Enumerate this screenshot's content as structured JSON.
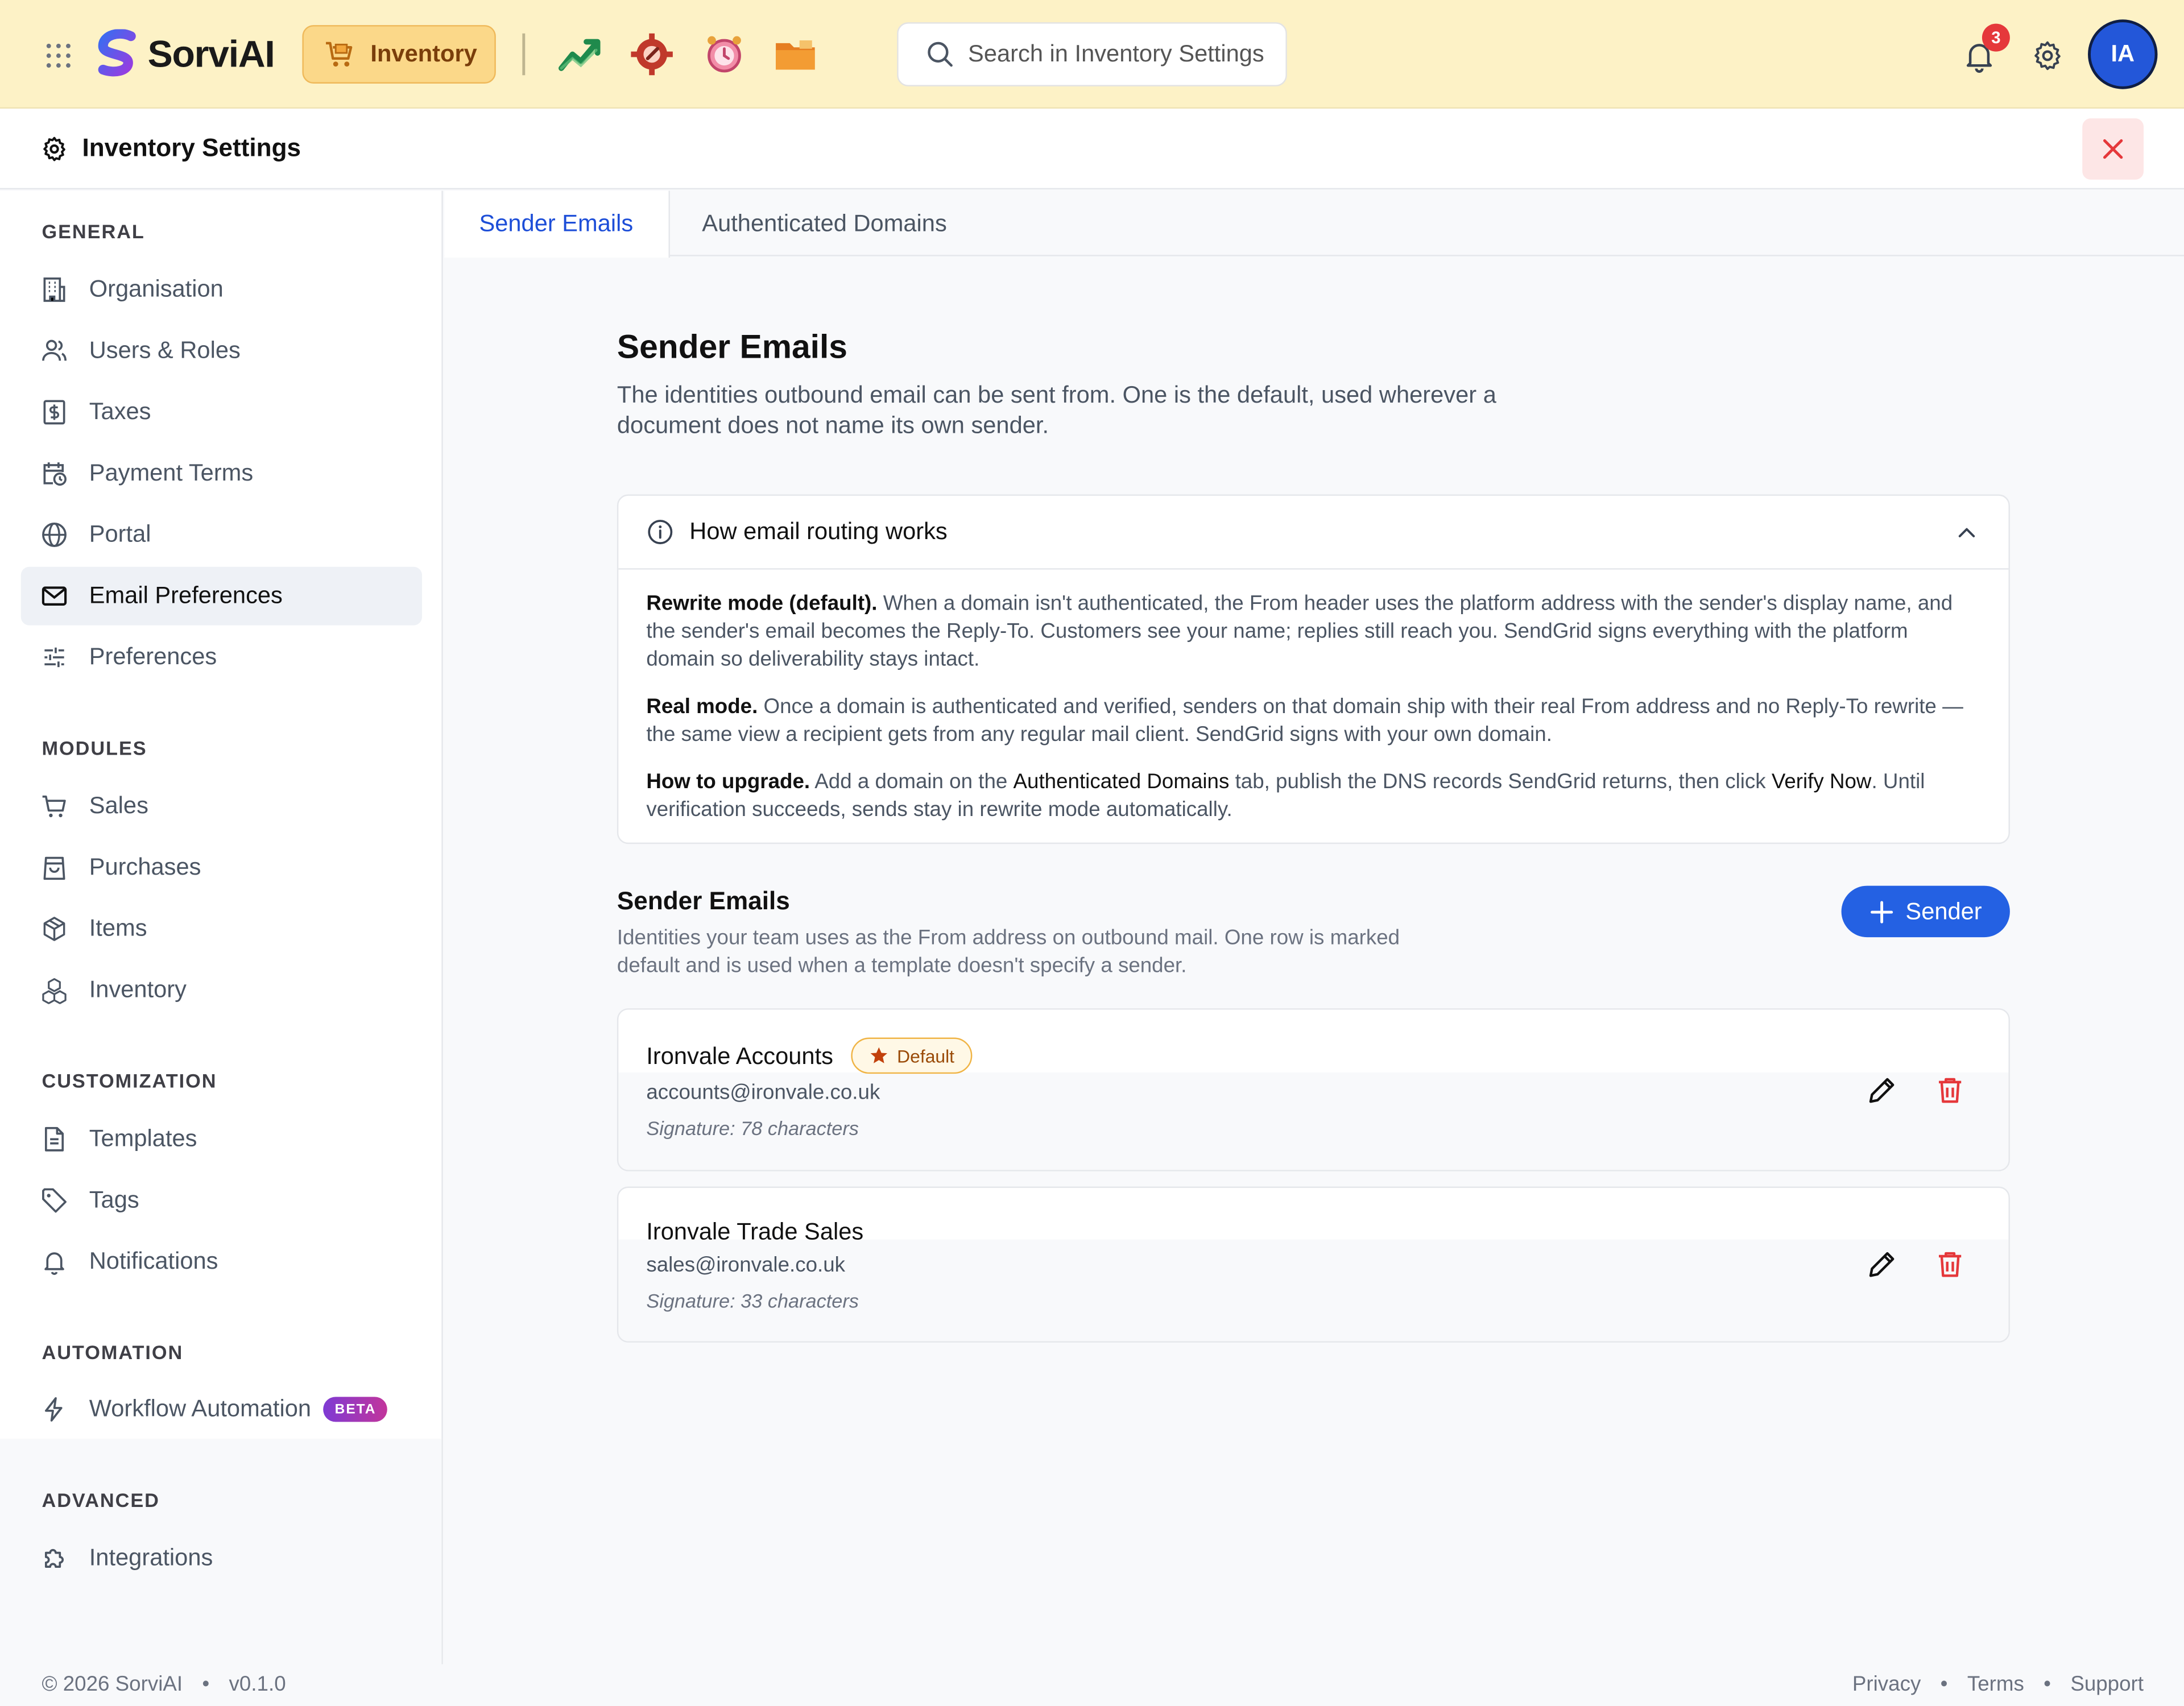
{
  "topbar": {
    "brand": "SorviAI",
    "module_label": "Inventory",
    "search_placeholder": "Search in Inventory Settings",
    "notification_count": "3",
    "avatar_initials": "IA",
    "app_icons": [
      "trending-up-icon",
      "wrench-gear-icon",
      "alarm-clock-icon",
      "folder-icon"
    ]
  },
  "settings_header": {
    "title": "Inventory Settings"
  },
  "sidebar": {
    "sections": [
      {
        "label": "GENERAL",
        "items": [
          {
            "label": "Organisation",
            "icon": "building-icon"
          },
          {
            "label": "Users & Roles",
            "icon": "users-icon"
          },
          {
            "label": "Taxes",
            "icon": "dollar-doc-icon"
          },
          {
            "label": "Payment Terms",
            "icon": "calendar-clock-icon"
          },
          {
            "label": "Portal",
            "icon": "globe-icon"
          },
          {
            "label": "Email Preferences",
            "icon": "mail-icon",
            "active": true
          },
          {
            "label": "Preferences",
            "icon": "sliders-icon"
          }
        ]
      },
      {
        "label": "MODULES",
        "items": [
          {
            "label": "Sales",
            "icon": "cart-icon"
          },
          {
            "label": "Purchases",
            "icon": "shopping-bag-icon"
          },
          {
            "label": "Items",
            "icon": "box-icon"
          },
          {
            "label": "Inventory",
            "icon": "boxes-icon"
          }
        ]
      },
      {
        "label": "CUSTOMIZATION",
        "items": [
          {
            "label": "Templates",
            "icon": "file-icon"
          },
          {
            "label": "Tags",
            "icon": "tag-icon"
          },
          {
            "label": "Notifications",
            "icon": "bell-icon"
          }
        ]
      },
      {
        "label": "AUTOMATION",
        "items": [
          {
            "label": "Workflow Automation",
            "icon": "lightning-icon",
            "badge": "BETA"
          }
        ]
      },
      {
        "label": "ADVANCED",
        "items": [
          {
            "label": "Integrations",
            "icon": "puzzle-icon"
          }
        ]
      }
    ]
  },
  "tabs": [
    {
      "label": "Sender Emails",
      "active": true
    },
    {
      "label": "Authenticated Domains",
      "active": false
    }
  ],
  "main": {
    "title": "Sender Emails",
    "subtitle": "The identities outbound email can be sent from. One is the default, used wherever a document does not name its own sender.",
    "info": {
      "title": "How email routing works",
      "p1_lead": "Rewrite mode (default).",
      "p1_text": " When a domain isn't authenticated, the From header uses the platform address with the sender's display name, and the sender's email becomes the Reply-To. Customers see your name; replies still reach you. SendGrid signs everything with the platform domain so deliverability stays intact.",
      "p2_lead": "Real mode.",
      "p2_text": " Once a domain is authenticated and verified, senders on that domain ship with their real From address and no Reply-To rewrite — the same view a recipient gets from any regular mail client. SendGrid signs with your own domain.",
      "p3_lead": "How to upgrade.",
      "p3_a": " Add a domain on the ",
      "p3_b": "Authenticated Domains",
      "p3_c": " tab, publish the DNS records SendGrid returns, then click ",
      "p3_d": "Verify Now",
      "p3_e": ". Until verification succeeds, sends stay in rewrite mode automatically."
    },
    "list_title": "Sender Emails",
    "list_subtitle": "Identities your team uses as the From address on outbound mail. One row is marked default and is used when a template doesn't specify a sender.",
    "add_button": "Sender",
    "senders": [
      {
        "name": "Ironvale Accounts",
        "badge": "Default",
        "email": "accounts@ironvale.co.uk",
        "signature": "Signature: 78 characters"
      },
      {
        "name": "Ironvale Trade Sales",
        "email": "sales@ironvale.co.uk",
        "signature": "Signature: 33 characters"
      }
    ]
  },
  "footer": {
    "copyright": "© 2026 SorviAI",
    "version": "v0.1.0",
    "links": [
      "Privacy",
      "Terms",
      "Support"
    ],
    "separator": "•"
  },
  "colors": {
    "topbar_bg": "#fdf2c6",
    "accent_blue": "#2461e3",
    "danger_red": "#e5383b",
    "active_nav_bg": "#eef1f6"
  }
}
